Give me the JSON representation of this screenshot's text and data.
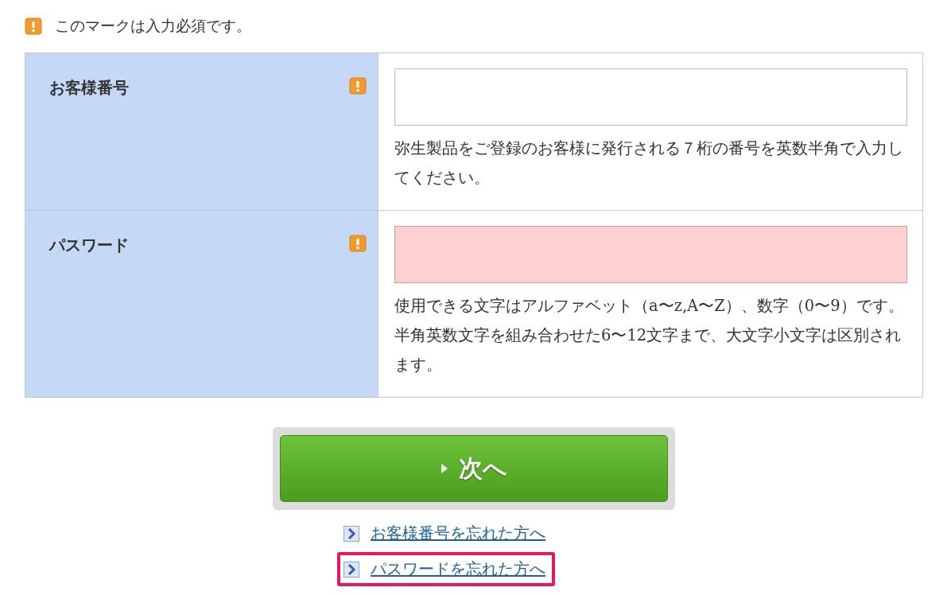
{
  "required_note": "このマークは入力必須です。",
  "rows": [
    {
      "label": "お客様番号",
      "required": true,
      "invalid": false,
      "help": [
        "弥生製品をご登録のお客様に発行される７桁の番号を英数半角で入力してください。"
      ]
    },
    {
      "label": "パスワード",
      "required": true,
      "invalid": true,
      "help": [
        "使用できる文字はアルファベット（a〜z,A〜Z）、数字（0〜9）です。",
        "半角英数文字を組み合わせた6〜12文字まで、大文字小文字は区別されます。"
      ]
    }
  ],
  "next_button": "次へ",
  "links": [
    {
      "label": "お客様番号を忘れた方へ",
      "highlighted": false
    },
    {
      "label": "パスワードを忘れた方へ",
      "highlighted": true
    }
  ]
}
